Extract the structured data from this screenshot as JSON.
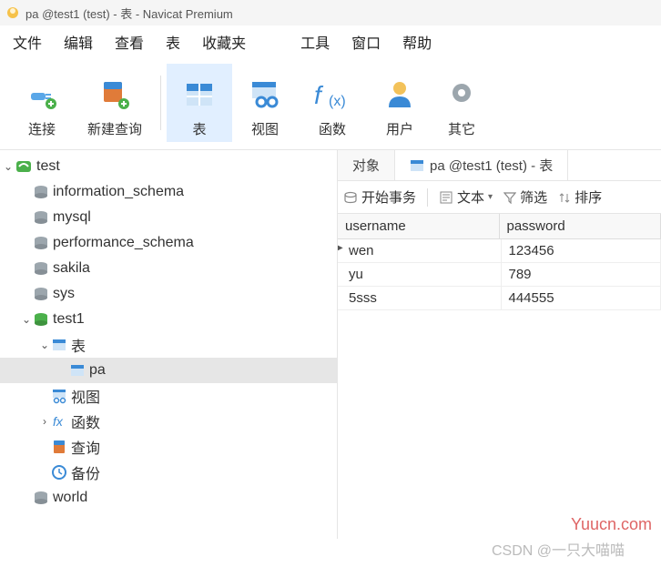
{
  "window": {
    "title": "pa @test1 (test) - 表 - Navicat Premium"
  },
  "menu": [
    "文件",
    "编辑",
    "查看",
    "表",
    "收藏夹",
    "工具",
    "窗口",
    "帮助"
  ],
  "toolbar": {
    "connect": "连接",
    "new_query": "新建查询",
    "table": "表",
    "view": "视图",
    "function": "函数",
    "user": "用户",
    "other": "其它"
  },
  "tree": {
    "test": "test",
    "info_schema": "information_schema",
    "mysql": "mysql",
    "perf_schema": "performance_schema",
    "sakila": "sakila",
    "sys": "sys",
    "test1": "test1",
    "tables": "表",
    "pa": "pa",
    "views": "视图",
    "functions": "函数",
    "queries": "查询",
    "backups": "备份",
    "world": "world"
  },
  "tabs": {
    "objects": "对象",
    "table_tab": "pa @test1 (test) - 表"
  },
  "actions": {
    "begin_tx": "开始事务",
    "text": "文本",
    "filter": "筛选",
    "sort": "排序"
  },
  "grid": {
    "columns": [
      "username",
      "password"
    ],
    "rows": [
      {
        "c0": "wen",
        "c1": "123456"
      },
      {
        "c0": "yu",
        "c1": "789"
      },
      {
        "c0": "5sss",
        "c1": "444555"
      }
    ]
  },
  "watermark1": "Yuucn.com",
  "watermark2": "CSDN @一只大喵喵"
}
